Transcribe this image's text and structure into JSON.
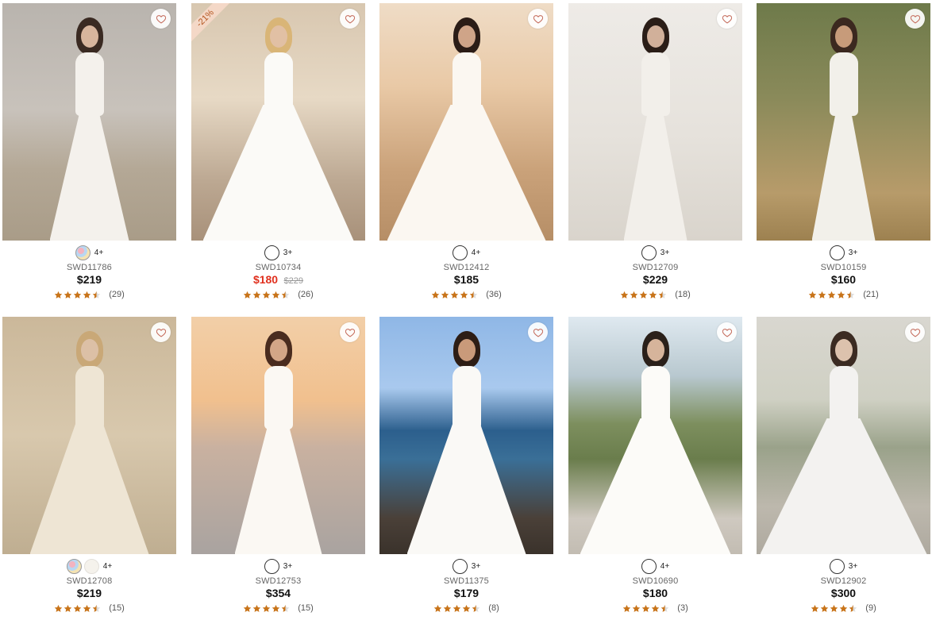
{
  "products": [
    {
      "sku": "SWD11786",
      "price": "$219",
      "original_price": "",
      "sale": false,
      "discount": "",
      "swatch_more": "4+",
      "swatches": [
        "multi"
      ],
      "rating": 4.5,
      "reviews": "(29)"
    },
    {
      "sku": "SWD10734",
      "price": "$180",
      "original_price": "$229",
      "sale": true,
      "discount": "-21%",
      "swatch_more": "3+",
      "swatches": [
        "white"
      ],
      "rating": 4.5,
      "reviews": "(26)"
    },
    {
      "sku": "SWD12412",
      "price": "$185",
      "original_price": "",
      "sale": false,
      "discount": "",
      "swatch_more": "4+",
      "swatches": [
        "white"
      ],
      "rating": 4.5,
      "reviews": "(36)"
    },
    {
      "sku": "SWD12709",
      "price": "$229",
      "original_price": "",
      "sale": false,
      "discount": "",
      "swatch_more": "3+",
      "swatches": [
        "white"
      ],
      "rating": 4.5,
      "reviews": "(18)"
    },
    {
      "sku": "SWD10159",
      "price": "$160",
      "original_price": "",
      "sale": false,
      "discount": "",
      "swatch_more": "3+",
      "swatches": [
        "white"
      ],
      "rating": 4.5,
      "reviews": "(21)"
    },
    {
      "sku": "SWD12708",
      "price": "$219",
      "original_price": "",
      "sale": false,
      "discount": "",
      "swatch_more": "4+",
      "swatches": [
        "multi",
        "ivory"
      ],
      "rating": 4.5,
      "reviews": "(15)"
    },
    {
      "sku": "SWD12753",
      "price": "$354",
      "original_price": "",
      "sale": false,
      "discount": "",
      "swatch_more": "3+",
      "swatches": [
        "white"
      ],
      "rating": 4.5,
      "reviews": "(15)"
    },
    {
      "sku": "SWD11375",
      "price": "$179",
      "original_price": "",
      "sale": false,
      "discount": "",
      "swatch_more": "3+",
      "swatches": [
        "white"
      ],
      "rating": 4.5,
      "reviews": "(8)"
    },
    {
      "sku": "SWD10690",
      "price": "$180",
      "original_price": "",
      "sale": false,
      "discount": "",
      "swatch_more": "4+",
      "swatches": [
        "white"
      ],
      "rating": 4.5,
      "reviews": "(3)"
    },
    {
      "sku": "SWD12902",
      "price": "$300",
      "original_price": "",
      "sale": false,
      "discount": "",
      "swatch_more": "3+",
      "swatches": [
        "white"
      ],
      "rating": 4.5,
      "reviews": "(9)"
    }
  ],
  "colors": {
    "star": "#c8741a",
    "sale_price": "#e0301e",
    "heart": "#c46a5a"
  },
  "icons": {
    "favorite": "heart-icon",
    "rating": "star-icon"
  }
}
